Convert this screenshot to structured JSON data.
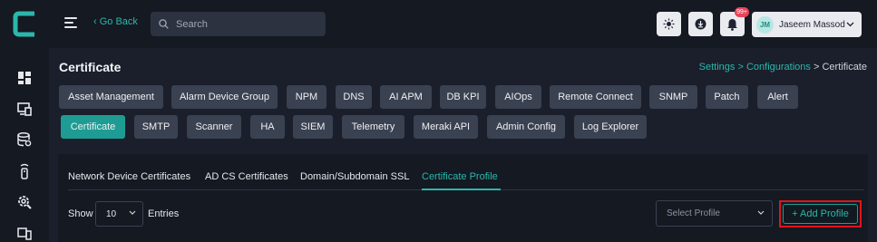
{
  "colors": {
    "accent": "#2bb7ad",
    "active_button": "#1e9c94",
    "highlight": "#e0151b",
    "badge": "#e8435a"
  },
  "sidebar": {
    "icons": [
      "dashboard-icon",
      "devices-icon",
      "database-icon",
      "remote-icon",
      "settings-search-icon",
      "monitor-icon"
    ]
  },
  "topbar": {
    "go_back": "‹ Go Back",
    "search_placeholder": "Search",
    "notification_count": "99+",
    "user": {
      "initials": "JM",
      "name": "Jaseem Massod"
    }
  },
  "page": {
    "title": "Certificate",
    "breadcrumb": {
      "level1": "Settings",
      "sep": ">",
      "level2": "Configurations",
      "current": "Certificate"
    }
  },
  "nav_buttons_row1": [
    "Asset Management",
    "Alarm Device Group",
    "NPM",
    "DNS",
    "AI APM",
    "DB KPI",
    "AIOps",
    "Remote Connect",
    "SNMP",
    "Patch",
    "Alert"
  ],
  "nav_buttons_row2": [
    "Certificate",
    "SMTP",
    "Scanner",
    "HA",
    "SIEM",
    "Telemetry",
    "Meraki API",
    "Admin Config",
    "Log Explorer"
  ],
  "active_nav": "Certificate",
  "tabs": [
    "Network Device Certificates",
    "AD CS Certificates",
    "Domain/Subdomain SSL",
    "Certificate Profile"
  ],
  "active_tab": "Certificate Profile",
  "table_controls": {
    "show_label": "Show",
    "entries_value": "10",
    "entries_label": "Entries",
    "profile_select_placeholder": "Select Profile",
    "add_button": "+ Add Profile"
  }
}
